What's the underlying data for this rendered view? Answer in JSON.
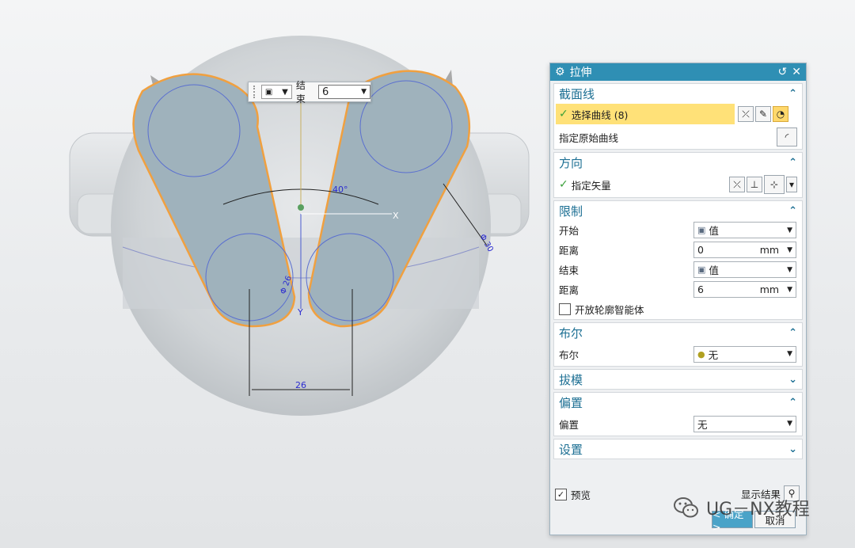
{
  "canvas": {
    "dim_angle": "40°",
    "dim_width": "26",
    "dim_radius_right": "Φ 30",
    "dim_radius_bottom": "Φ 26",
    "axis_x": "X",
    "axis_y": "Y"
  },
  "mini_toolbar": {
    "label": "结束",
    "value": "6"
  },
  "dialog": {
    "title": "拉伸",
    "sections": {
      "section_curve": {
        "header": "截面线",
        "select_curve": "选择曲线 (8)",
        "specify_original": "指定原始曲线"
      },
      "direction": {
        "header": "方向",
        "specify_vector": "指定矢量"
      },
      "limits": {
        "header": "限制",
        "start_label": "开始",
        "start_value": "值",
        "distance1_label": "距离",
        "distance1_value": "0",
        "end_label": "结束",
        "end_value": "值",
        "distance2_label": "距离",
        "distance2_value": "6",
        "unit": "mm",
        "open_profile": "开放轮廓智能体"
      },
      "boolean": {
        "header": "布尔",
        "label": "布尔",
        "value": "无"
      },
      "draft": {
        "header": "拔模"
      },
      "offset": {
        "header": "偏置",
        "label": "偏置",
        "value": "无"
      },
      "settings": {
        "header": "设置"
      }
    },
    "preview_label": "预览",
    "show_result": "显示结果",
    "ok_label": "< 确定 >",
    "cancel_label": "取消"
  },
  "watermark": "UG－NX教程",
  "colors": {
    "title_bar": "#2f8fb4",
    "section_header": "#1c6f93",
    "highlight": "#ffe178",
    "sketch_outline": "#f0a040",
    "body_fill": "#9fb2bc"
  }
}
